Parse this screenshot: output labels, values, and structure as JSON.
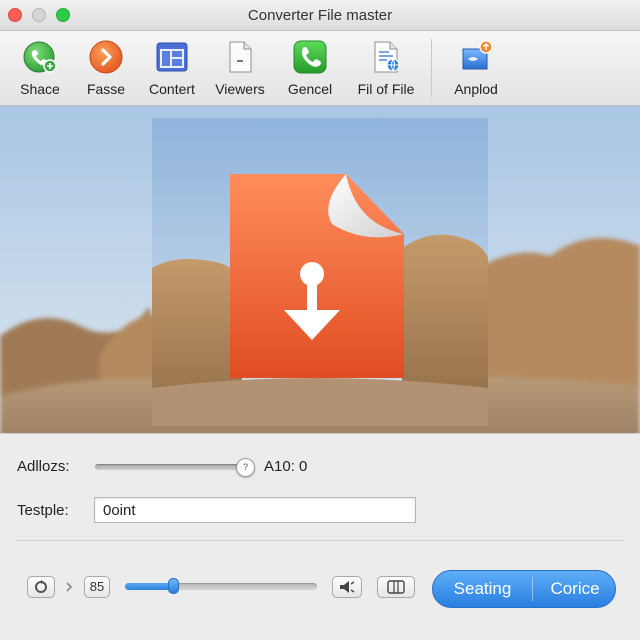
{
  "window": {
    "title": "Converter File master"
  },
  "toolbar": {
    "items": [
      {
        "label": "Shace",
        "icon": "green-share-icon"
      },
      {
        "label": "Fasse",
        "icon": "orange-arrow-icon"
      },
      {
        "label": "Contert",
        "icon": "blue-window-icon"
      },
      {
        "label": "Viewers",
        "icon": "document-icon"
      },
      {
        "label": "Gencel",
        "icon": "green-phone-icon"
      },
      {
        "label": "Fil of File",
        "icon": "file-globe-icon"
      },
      {
        "label": "Anplod",
        "icon": "upload-badge-icon"
      }
    ]
  },
  "preview": {
    "icon": "orange-file-download-icon"
  },
  "controls": {
    "adjust_label": "Adllozs:",
    "adjust_value": "A10: 0",
    "adjust_knob_mark": "?",
    "template_label": "Testple:",
    "template_value": "0oint"
  },
  "bottom": {
    "counter": "85",
    "progress_fraction": 0.25,
    "seg_left": "Seating",
    "seg_right": "Corice"
  },
  "colors": {
    "accent": "#2f86dc",
    "file_orange": "#ef6a3a",
    "close": "#fb5e55",
    "maximize": "#2fcb48"
  }
}
